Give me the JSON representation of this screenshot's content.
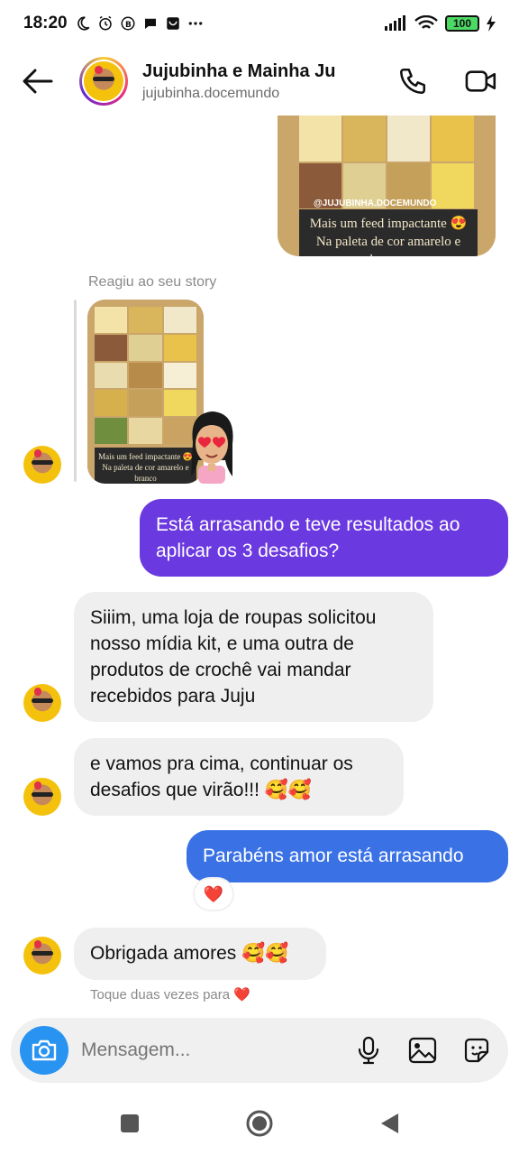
{
  "status_bar": {
    "time": "18:20",
    "battery": "100"
  },
  "header": {
    "title": "Jujubinha e Mainha Ju",
    "username": "jujubinha.docemundo",
    "icons": [
      "back-arrow-icon",
      "phone-icon",
      "video-icon"
    ]
  },
  "shared_story": {
    "caption_line1": "Mais um feed impactante 😍",
    "caption_line2": "Na paleta de cor amarelo e",
    "caption_line3": "branco",
    "tag": "@JUJUBINHA.DOCEMUNDO"
  },
  "story_reply": {
    "label": "Reagiu ao seu story",
    "thumb_caption": "Mais um feed impactante 😍 Na paleta de cor amarelo e branco",
    "reaction_emoji": "😍"
  },
  "messages": [
    {
      "from": "me",
      "text": "Está arrasando e teve resultados ao aplicar os 3 desafios?"
    },
    {
      "from": "them",
      "text": "Siiim, uma loja de roupas solicitou nosso mídia kit, e uma outra de produtos de crochê vai mandar recebidos para Juju"
    },
    {
      "from": "them",
      "text": "e vamos pra cima, continuar os desafios que virão!!! 🥰🥰"
    },
    {
      "from": "me",
      "text": "Parabéns amor está arrasando",
      "reaction": "❤️"
    },
    {
      "from": "them",
      "text": "Obrigada amores 🥰🥰"
    }
  ],
  "hint": "Toque duas vezes para ❤️",
  "composer": {
    "placeholder": "Mensagem...",
    "icons": [
      "camera-icon",
      "microphone-icon",
      "gallery-icon",
      "sticker-icon"
    ]
  },
  "colors": {
    "outgoing_purple": "#6b39e0",
    "outgoing_blue": "#3a72e6",
    "incoming_gray": "#efefef",
    "camera_blue": "#2893f0"
  }
}
